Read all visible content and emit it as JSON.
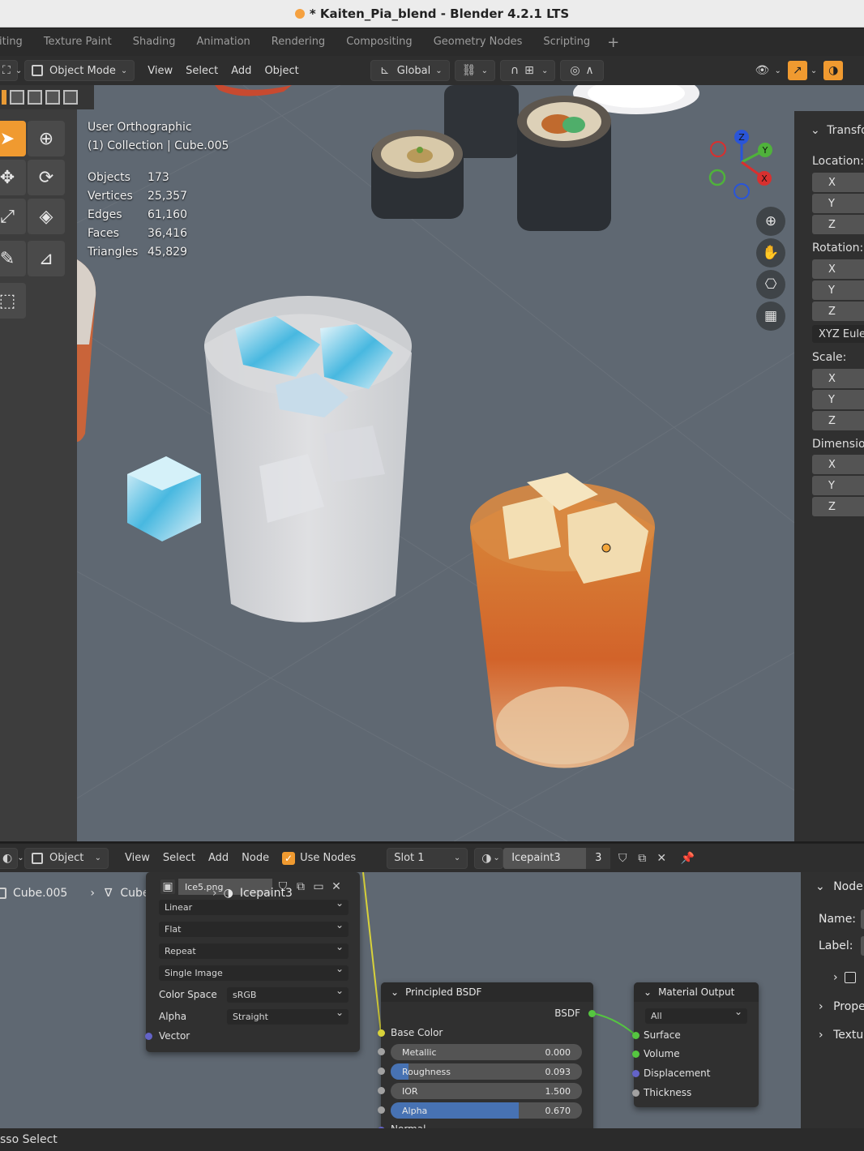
{
  "window": {
    "title": "* Kaiten_Pia_blend - Blender 4.2.1 LTS"
  },
  "workspace_tabs": [
    "iting",
    "Texture Paint",
    "Shading",
    "Animation",
    "Rendering",
    "Compositing",
    "Geometry Nodes",
    "Scripting"
  ],
  "viewport_header": {
    "mode": "Object Mode",
    "menus": [
      "View",
      "Select",
      "Add",
      "Object"
    ],
    "transform_orientation": "Global"
  },
  "viewport": {
    "view_name": "User Orthographic",
    "collection_line": "(1) Collection | Cube.005",
    "stats": [
      {
        "label": "Objects",
        "value": "173"
      },
      {
        "label": "Vertices",
        "value": "25,357"
      },
      {
        "label": "Edges",
        "value": "61,160"
      },
      {
        "label": "Faces",
        "value": "36,416"
      },
      {
        "label": "Triangles",
        "value": "45,829"
      }
    ],
    "gizmo_axes": {
      "z": "Z",
      "y": "Y",
      "x": "X"
    }
  },
  "n_panel": {
    "header": "Transfo",
    "location_label": "Location:",
    "rotation_label": "Rotation:",
    "rotation_mode": "XYZ Eule",
    "scale_label": "Scale:",
    "dimensions_label": "Dimension",
    "axes": [
      "X",
      "Y",
      "Z"
    ]
  },
  "node_header": {
    "type": "Object",
    "menus": [
      "View",
      "Select",
      "Add",
      "Node"
    ],
    "use_nodes_label": "Use Nodes",
    "slot": "Slot 1",
    "material_name": "Icepaint3",
    "user_count": "3"
  },
  "breadcrumb": {
    "object": "Cube.005",
    "mesh": "Cube.005",
    "material": "Icepaint3"
  },
  "image_node": {
    "image_name": "Ice5.png",
    "interpolation": "Linear",
    "projection": "Flat",
    "extension": "Repeat",
    "source": "Single Image",
    "color_space_label": "Color Space",
    "color_space": "sRGB",
    "alpha_label": "Alpha",
    "alpha_mode": "Straight",
    "vector_label": "Vector"
  },
  "bsdf_node": {
    "title": "Principled BSDF",
    "output": "BSDF",
    "base_color_label": "Base Color",
    "metallic": {
      "label": "Metallic",
      "value": "0.000",
      "fraction": 0.0
    },
    "roughness": {
      "label": "Roughness",
      "value": "0.093",
      "fraction": 0.093
    },
    "ior": {
      "label": "IOR",
      "value": "1.500"
    },
    "alpha": {
      "label": "Alpha",
      "value": "0.670",
      "fraction": 0.67
    },
    "normal_label": "Normal"
  },
  "output_node": {
    "title": "Material Output",
    "target": "All",
    "inputs": [
      "Surface",
      "Volume",
      "Displacement",
      "Thickness"
    ]
  },
  "node_side_panel": {
    "header": "Node",
    "name_label": "Name:",
    "label_label": "Label:",
    "properties": "Prope",
    "texture": "Textu"
  },
  "status_bar": {
    "text": "sso Select"
  },
  "colors": {
    "accent": "#f09a30",
    "viewport_bg": "#5f6872",
    "slider_fill": "#4772b3"
  }
}
